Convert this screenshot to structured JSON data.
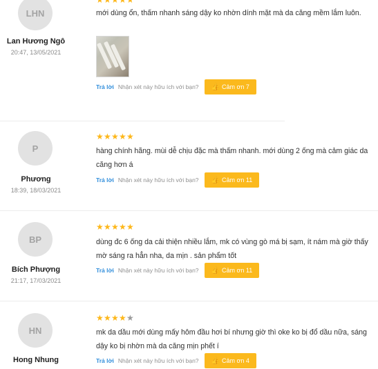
{
  "actions": {
    "reply_label": "Trả lời",
    "helpful_question": "Nhận xét này hữu ích với bạn?",
    "thanks_icon": "thumbs-up-icon"
  },
  "colors": {
    "star": "#fdb71a",
    "thanks_button": "#fbb91d",
    "reply_link": "#2f8ddb"
  },
  "reviews": [
    {
      "initials": "LHN",
      "name": "Lan Hương Ngô",
      "date": "20:47, 13/05/2021",
      "rating": 5,
      "text": "mới dùng ổn, thấm nhanh sáng dậy ko nhờn dính mặt mà da căng mềm lắm luôn.",
      "has_photo": true,
      "thanks_label": "Cảm ơn 7"
    },
    {
      "initials": "P",
      "name": "Phương",
      "date": "18:39, 18/03/2021",
      "rating": 5,
      "text": "hàng  chính hãng. mùi dễ chịu đặc mà thấm nhanh. mới dùng 2 ống mà cảm giác da căng hơn á",
      "has_photo": false,
      "thanks_label": "Cảm ơn 11"
    },
    {
      "initials": "BP",
      "name": "Bích Phượng",
      "date": "21:17, 17/03/2021",
      "rating": 5,
      "text": "dùng đc 6 ống da cải thiện nhiều lắm, mk có vùng gò má bị sạm, ít nám mà giờ thấy mờ sáng ra hẳn nha, da mịn . sản phẩm tốt",
      "has_photo": false,
      "thanks_label": "Cảm ơn 11"
    },
    {
      "initials": "HN",
      "name": "Hong Nhung",
      "date": "",
      "rating": 4,
      "text": "mk da dầu mới dùng mấy hôm đầu hơi bí nhưng giờ thì oke ko bị đổ dầu nữa, sáng dậy ko bị nhờn mà da căng mịn phết í",
      "has_photo": false,
      "thanks_label": "Cảm ơn 4"
    }
  ]
}
